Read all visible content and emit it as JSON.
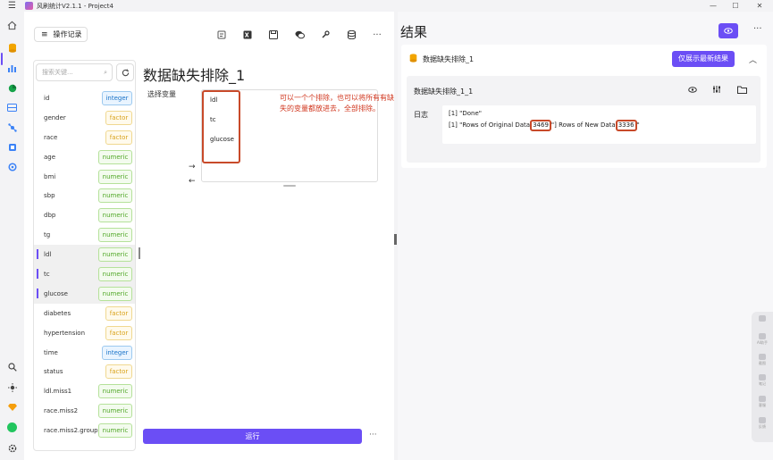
{
  "app": {
    "title": "风刷统计V2.1.1 - Project4"
  },
  "left": {
    "log_button": "操作记录",
    "search_placeholder": "搜索关键...",
    "variables": [
      {
        "name": "id",
        "type": "integer",
        "selected": false
      },
      {
        "name": "gender",
        "type": "factor",
        "selected": false
      },
      {
        "name": "race",
        "type": "factor",
        "selected": false
      },
      {
        "name": "age",
        "type": "numeric",
        "selected": false
      },
      {
        "name": "bmi",
        "type": "numeric",
        "selected": false
      },
      {
        "name": "sbp",
        "type": "numeric",
        "selected": false
      },
      {
        "name": "dbp",
        "type": "numeric",
        "selected": false
      },
      {
        "name": "tg",
        "type": "numeric",
        "selected": false
      },
      {
        "name": "ldl",
        "type": "numeric",
        "selected": true
      },
      {
        "name": "tc",
        "type": "numeric",
        "selected": true
      },
      {
        "name": "glucose",
        "type": "numeric",
        "selected": true
      },
      {
        "name": "diabetes",
        "type": "factor",
        "selected": false
      },
      {
        "name": "hypertension",
        "type": "factor",
        "selected": false
      },
      {
        "name": "time",
        "type": "integer",
        "selected": false
      },
      {
        "name": "status",
        "type": "factor",
        "selected": false
      },
      {
        "name": "ldl.miss1",
        "type": "numeric",
        "selected": false
      },
      {
        "name": "race.miss2",
        "type": "numeric",
        "selected": false
      },
      {
        "name": "race.miss2.group",
        "type": "numeric",
        "selected": false
      }
    ],
    "module_title": "数据缺失排除_1",
    "select_label": "选择变量",
    "selected_vars": [
      "ldl",
      "tc",
      "glucose"
    ],
    "annotation": "可以一个个排除，也可以将所有有缺失的变量都放进去，全部排除。",
    "run_label": "运行",
    "more": "···"
  },
  "right": {
    "title": "结果",
    "more": "···",
    "card_name": "数据缺失排除_1",
    "latest_button": "仅展示最新结果",
    "inner_title": "数据缺失排除_1_1",
    "log_label": "日志",
    "log_line1": "[1] \"Done\"",
    "log_line2_prefix": "[1] \"Rows of Original Data",
    "orig_rows": "3469",
    "log_line2_mid": "\"] Rows of New Data",
    "new_rows": "3336",
    "log_line2_suffix": "\""
  },
  "float_panel": [
    "AI助手",
    "截图",
    "笔记",
    "客服",
    "反馈"
  ],
  "colors": {
    "accent": "#6b4ef5",
    "annotation_red": "#d0351d",
    "integer": "#1a73c8",
    "factor": "#d9a21b",
    "numeric": "#52a829"
  }
}
